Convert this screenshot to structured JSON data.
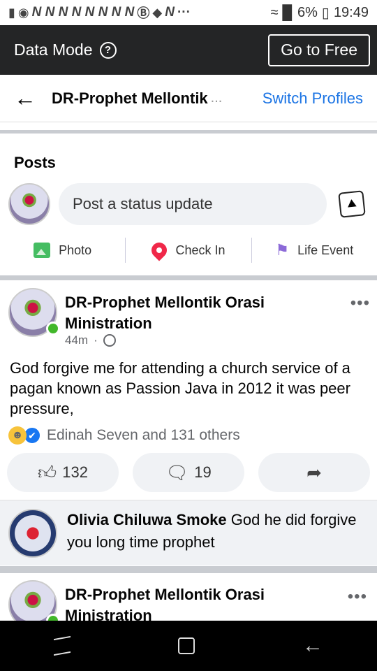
{
  "statusbar": {
    "left_icons": [
      "alert-icon",
      "facebook-icon",
      "N",
      "N",
      "N",
      "N",
      "N",
      "N",
      "N",
      "N",
      "b-icon",
      "messenger-icon",
      "N",
      "•••"
    ],
    "battery": "6%",
    "time": "19:49"
  },
  "databar": {
    "label": "Data Mode",
    "help": "?",
    "button": "Go to Free"
  },
  "header": {
    "title": "DR-Prophet Mellontik",
    "ellipsis": "...",
    "switch": "Switch Profiles"
  },
  "posts_section": {
    "heading": "Posts",
    "status_placeholder": "Post a status update",
    "actions": [
      {
        "label": "Photo",
        "icon": "photo-icon"
      },
      {
        "label": "Check In",
        "icon": "location-pin-icon"
      },
      {
        "label": "Life Event",
        "icon": "flag-icon"
      }
    ]
  },
  "post": {
    "author": "DR-Prophet Mellontik Orasi Ministration",
    "time": "44m",
    "separator": "·",
    "text": "God forgive me for attending a church service of a pagan known as Passion Java in 2012 it was peer pressure,",
    "reactions_text": "Edinah Seven and 131 others",
    "like_count": "132",
    "comment_count": "19"
  },
  "comment": {
    "name": "Olivia Chiluwa Smoke",
    "text": " God he did forgive  you long time  prophet"
  },
  "post2": {
    "author": "DR-Prophet Mellontik Orasi Ministration"
  },
  "colors": {
    "accent": "#1b74e4",
    "databar_bg": "#242526",
    "online": "#42b72a",
    "pill_bg": "#f0f2f5"
  }
}
